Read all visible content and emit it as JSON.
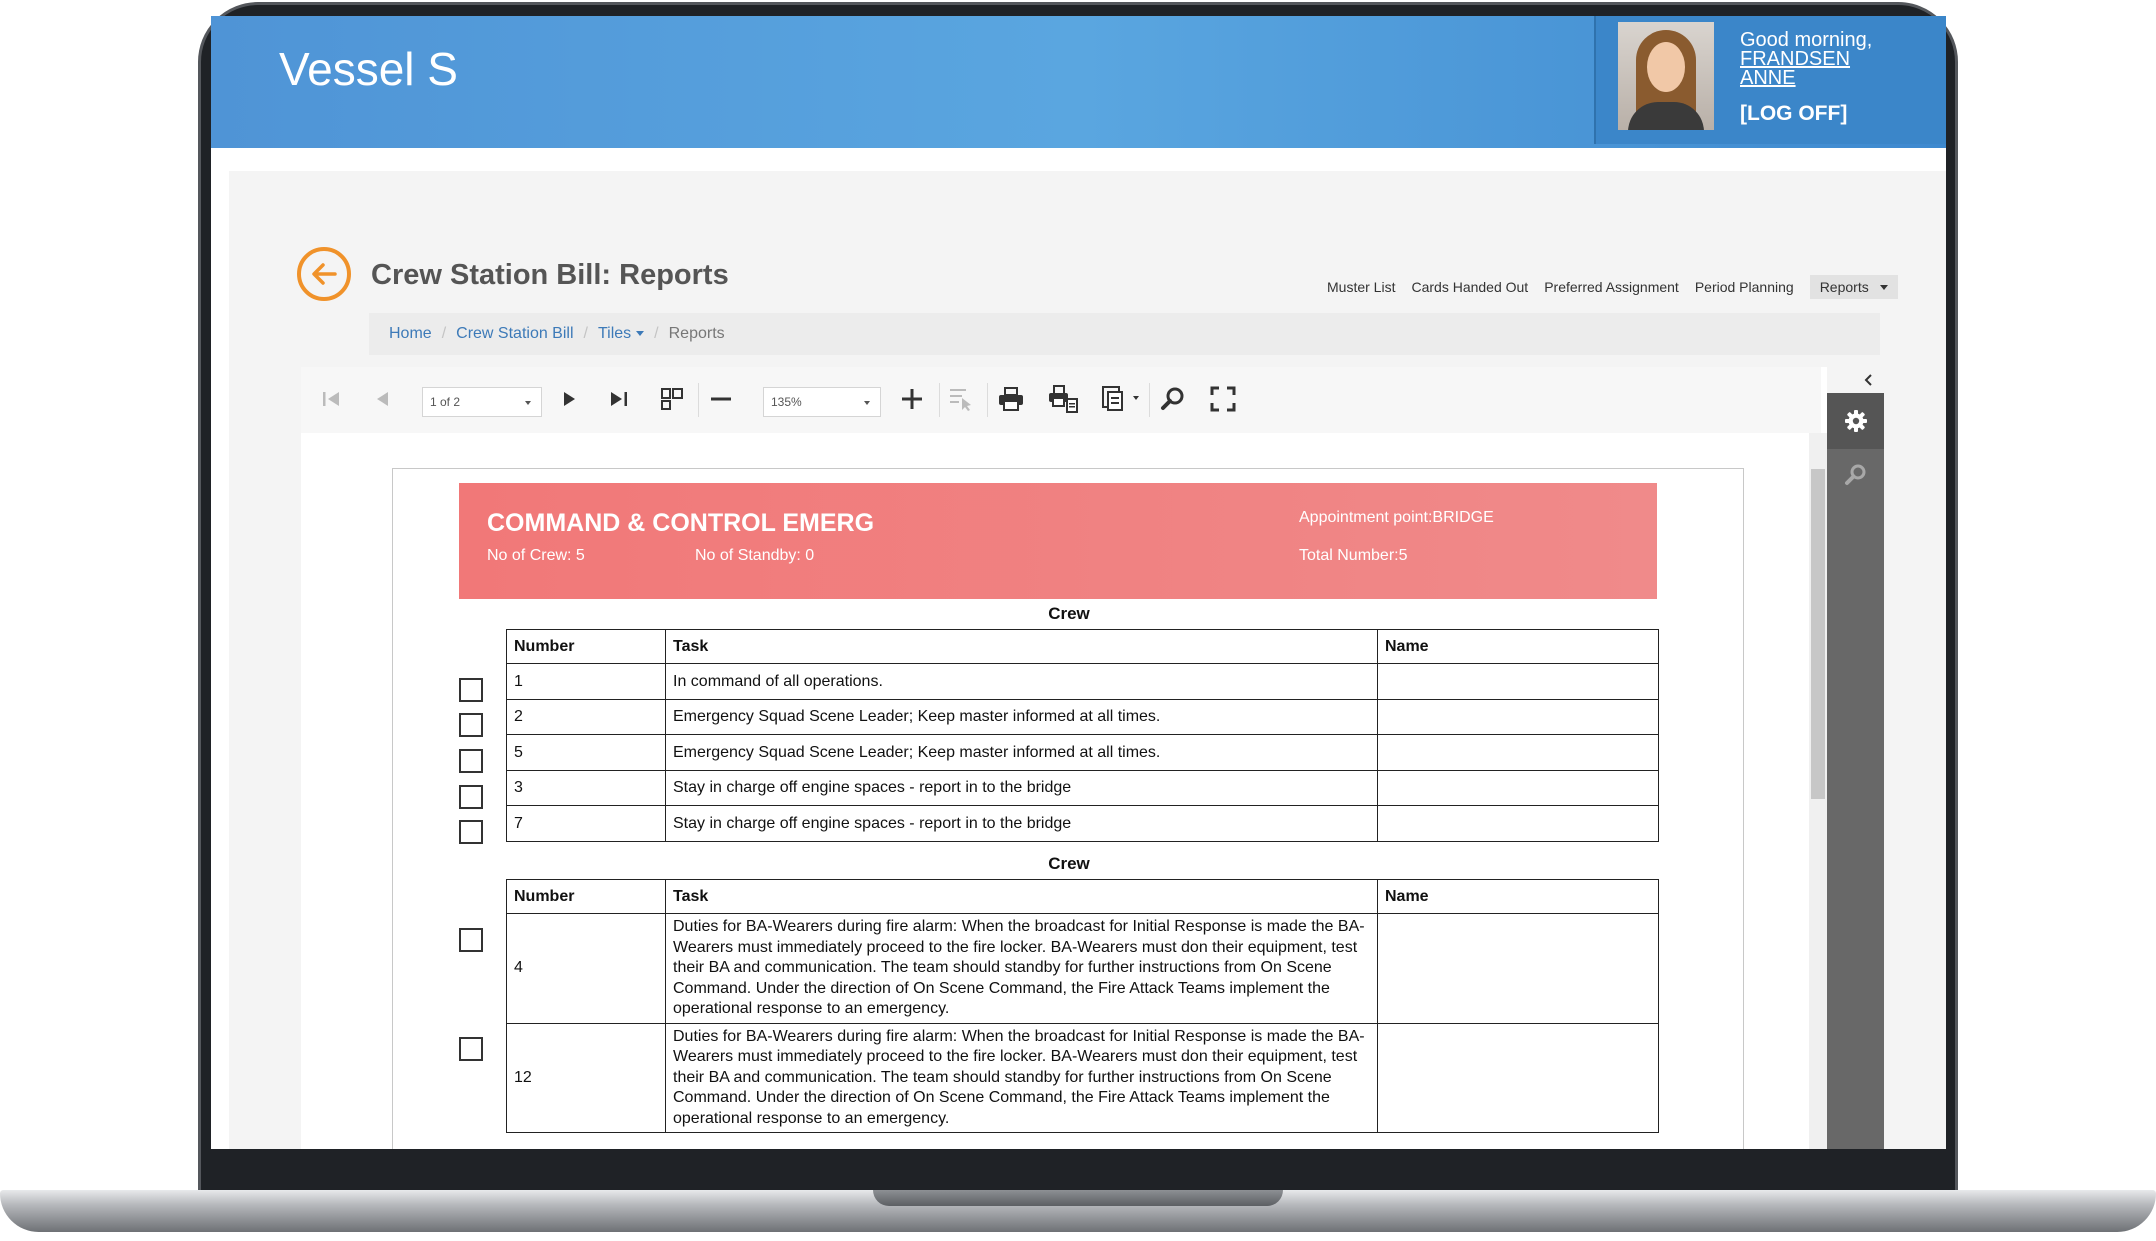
{
  "app": {
    "title": "Vessel S"
  },
  "user": {
    "greeting": "Good morning,",
    "surname": "FRANDSEN",
    "first_name": "ANNE",
    "logoff": "[LOG OFF]"
  },
  "page": {
    "title": "Crew Station Bill: Reports"
  },
  "topnav": {
    "items": [
      "Muster List",
      "Cards Handed Out",
      "Preferred Assignment",
      "Period Planning"
    ],
    "reports": "Reports"
  },
  "breadcrumb": {
    "home": "Home",
    "crew_station_bill": "Crew Station Bill",
    "tiles": "Tiles",
    "current": "Reports"
  },
  "toolbar": {
    "page_select": "1 of 2",
    "zoom_select": "135%"
  },
  "report": {
    "header": {
      "title": "COMMAND &  CONTROL EMERG",
      "no_of_crew": "No of Crew: 5",
      "no_of_standby": "No of Standby: 0",
      "appointment": "Appointment point:BRIDGE",
      "total": "Total Number:5"
    },
    "columns": [
      "Number",
      "Task",
      "Name"
    ],
    "section1": {
      "title": "Crew",
      "rows": [
        {
          "number": "1",
          "task": "In command of all operations.",
          "name": ""
        },
        {
          "number": "2",
          "task": "Emergency Squad Scene Leader; Keep master informed at all times.",
          "name": ""
        },
        {
          "number": "5",
          "task": "Emergency Squad Scene Leader; Keep master informed at all times.",
          "name": ""
        },
        {
          "number": "3",
          "task": "Stay in charge off engine spaces - report in to the bridge",
          "name": ""
        },
        {
          "number": "7",
          "task": "Stay in charge off engine spaces - report in to the bridge",
          "name": ""
        }
      ]
    },
    "section2": {
      "title": "Crew",
      "rows": [
        {
          "number": "4",
          "task": "Duties for BA-Wearers during fire alarm: When the broadcast for Initial Response is made the BA-Wearers must immediately proceed to the fire locker. BA-Wearers must don their equipment, test their BA and communication. The team should standby for further instructions from On Scene Command. Under the direction of On Scene Command, the Fire Attack Teams implement the operational response to an emergency.",
          "name": ""
        },
        {
          "number": "12",
          "task": "Duties for BA-Wearers during fire alarm: When the broadcast for Initial Response is made the BA-Wearers must immediately proceed to the fire locker. BA-Wearers must don their equipment, test their BA and communication. The team should standby for further instructions from On Scene Command. Under the direction of On Scene Command, the Fire Attack Teams implement the operational response to an emergency.",
          "name": ""
        }
      ]
    }
  },
  "icons": {
    "back": "arrow-left-circle-icon",
    "toolbar": [
      "first-page-icon",
      "prev-page-icon",
      "next-page-icon",
      "last-page-icon",
      "multipage-icon",
      "zoom-out-icon",
      "zoom-in-icon",
      "highlight-editing-icon",
      "print-icon",
      "print-page-icon",
      "export-icon",
      "search-icon",
      "fullscreen-icon"
    ],
    "side": [
      "chevron-left-icon",
      "gear-icon",
      "search-icon"
    ]
  },
  "colors": {
    "header_blue": "#4f94d6",
    "accent_orange": "#f0922a",
    "report_header": "#f17878",
    "link": "#3d7ab8"
  }
}
